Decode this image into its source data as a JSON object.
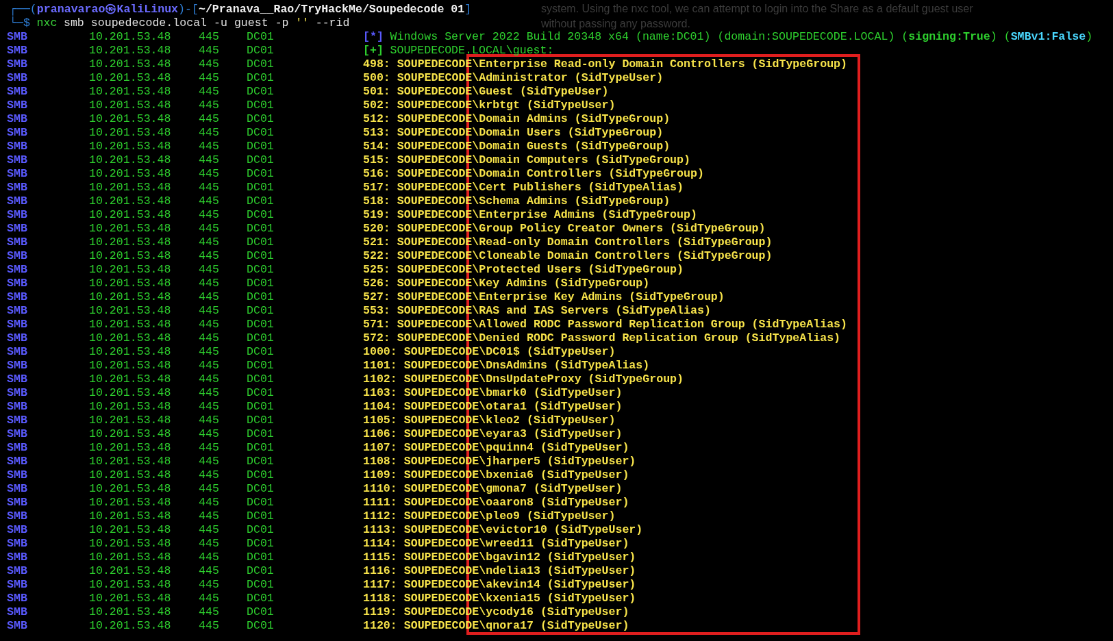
{
  "background_text": [
    "system. Using the nxc tool, we can attempt to login into the Share as a default guest user",
    "without passing any password."
  ],
  "prompt": {
    "frame_top": "┌──(",
    "user": "pranavarao㉿KaliLinux",
    "mid": ")-[",
    "path": "~/Pranava__Rao/TryHackMe/Soupedecode 01",
    "end": "]",
    "frame_bottom": "└─$",
    "command": "nxc",
    "args": "smb soupedecode.local -u guest -p",
    "quoted": "''",
    "flags": "--rid"
  },
  "rows": [
    {
      "proto": "SMB",
      "host": "10.201.53.48",
      "port": "445",
      "name": "DC01",
      "kind": "info",
      "marker": "[*]",
      "text": "Windows Server 2022 Build 20348 x64 (name:DC01) (domain:SOUPEDECODE.LOCAL) (**signing:True**) (**SMBv1:False**)"
    },
    {
      "proto": "SMB",
      "host": "10.201.53.48",
      "port": "445",
      "name": "DC01",
      "kind": "success",
      "marker": "[+]",
      "text": "SOUPEDECODE.LOCAL\\guest:"
    },
    {
      "proto": "SMB",
      "host": "10.201.53.48",
      "port": "445",
      "name": "DC01",
      "kind": "rid",
      "text": "498: SOUPEDECODE\\Enterprise Read-only Domain Controllers (SidTypeGroup)"
    },
    {
      "proto": "SMB",
      "host": "10.201.53.48",
      "port": "445",
      "name": "DC01",
      "kind": "rid",
      "text": "500: SOUPEDECODE\\Administrator (SidTypeUser)"
    },
    {
      "proto": "SMB",
      "host": "10.201.53.48",
      "port": "445",
      "name": "DC01",
      "kind": "rid",
      "text": "501: SOUPEDECODE\\Guest (SidTypeUser)"
    },
    {
      "proto": "SMB",
      "host": "10.201.53.48",
      "port": "445",
      "name": "DC01",
      "kind": "rid",
      "text": "502: SOUPEDECODE\\krbtgt (SidTypeUser)"
    },
    {
      "proto": "SMB",
      "host": "10.201.53.48",
      "port": "445",
      "name": "DC01",
      "kind": "rid",
      "text": "512: SOUPEDECODE\\Domain Admins (SidTypeGroup)"
    },
    {
      "proto": "SMB",
      "host": "10.201.53.48",
      "port": "445",
      "name": "DC01",
      "kind": "rid",
      "text": "513: SOUPEDECODE\\Domain Users (SidTypeGroup)"
    },
    {
      "proto": "SMB",
      "host": "10.201.53.48",
      "port": "445",
      "name": "DC01",
      "kind": "rid",
      "text": "514: SOUPEDECODE\\Domain Guests (SidTypeGroup)"
    },
    {
      "proto": "SMB",
      "host": "10.201.53.48",
      "port": "445",
      "name": "DC01",
      "kind": "rid",
      "text": "515: SOUPEDECODE\\Domain Computers (SidTypeGroup)"
    },
    {
      "proto": "SMB",
      "host": "10.201.53.48",
      "port": "445",
      "name": "DC01",
      "kind": "rid",
      "text": "516: SOUPEDECODE\\Domain Controllers (SidTypeGroup)"
    },
    {
      "proto": "SMB",
      "host": "10.201.53.48",
      "port": "445",
      "name": "DC01",
      "kind": "rid",
      "text": "517: SOUPEDECODE\\Cert Publishers (SidTypeAlias)"
    },
    {
      "proto": "SMB",
      "host": "10.201.53.48",
      "port": "445",
      "name": "DC01",
      "kind": "rid",
      "text": "518: SOUPEDECODE\\Schema Admins (SidTypeGroup)"
    },
    {
      "proto": "SMB",
      "host": "10.201.53.48",
      "port": "445",
      "name": "DC01",
      "kind": "rid",
      "text": "519: SOUPEDECODE\\Enterprise Admins (SidTypeGroup)"
    },
    {
      "proto": "SMB",
      "host": "10.201.53.48",
      "port": "445",
      "name": "DC01",
      "kind": "rid",
      "text": "520: SOUPEDECODE\\Group Policy Creator Owners (SidTypeGroup)"
    },
    {
      "proto": "SMB",
      "host": "10.201.53.48",
      "port": "445",
      "name": "DC01",
      "kind": "rid",
      "text": "521: SOUPEDECODE\\Read-only Domain Controllers (SidTypeGroup)"
    },
    {
      "proto": "SMB",
      "host": "10.201.53.48",
      "port": "445",
      "name": "DC01",
      "kind": "rid",
      "text": "522: SOUPEDECODE\\Cloneable Domain Controllers (SidTypeGroup)"
    },
    {
      "proto": "SMB",
      "host": "10.201.53.48",
      "port": "445",
      "name": "DC01",
      "kind": "rid",
      "text": "525: SOUPEDECODE\\Protected Users (SidTypeGroup)"
    },
    {
      "proto": "SMB",
      "host": "10.201.53.48",
      "port": "445",
      "name": "DC01",
      "kind": "rid",
      "text": "526: SOUPEDECODE\\Key Admins (SidTypeGroup)"
    },
    {
      "proto": "SMB",
      "host": "10.201.53.48",
      "port": "445",
      "name": "DC01",
      "kind": "rid",
      "text": "527: SOUPEDECODE\\Enterprise Key Admins (SidTypeGroup)"
    },
    {
      "proto": "SMB",
      "host": "10.201.53.48",
      "port": "445",
      "name": "DC01",
      "kind": "rid",
      "text": "553: SOUPEDECODE\\RAS and IAS Servers (SidTypeAlias)"
    },
    {
      "proto": "SMB",
      "host": "10.201.53.48",
      "port": "445",
      "name": "DC01",
      "kind": "rid",
      "text": "571: SOUPEDECODE\\Allowed RODC Password Replication Group (SidTypeAlias)"
    },
    {
      "proto": "SMB",
      "host": "10.201.53.48",
      "port": "445",
      "name": "DC01",
      "kind": "rid",
      "text": "572: SOUPEDECODE\\Denied RODC Password Replication Group (SidTypeAlias)"
    },
    {
      "proto": "SMB",
      "host": "10.201.53.48",
      "port": "445",
      "name": "DC01",
      "kind": "rid",
      "text": "1000: SOUPEDECODE\\DC01$ (SidTypeUser)"
    },
    {
      "proto": "SMB",
      "host": "10.201.53.48",
      "port": "445",
      "name": "DC01",
      "kind": "rid",
      "text": "1101: SOUPEDECODE\\DnsAdmins (SidTypeAlias)"
    },
    {
      "proto": "SMB",
      "host": "10.201.53.48",
      "port": "445",
      "name": "DC01",
      "kind": "rid",
      "text": "1102: SOUPEDECODE\\DnsUpdateProxy (SidTypeGroup)"
    },
    {
      "proto": "SMB",
      "host": "10.201.53.48",
      "port": "445",
      "name": "DC01",
      "kind": "rid",
      "text": "1103: SOUPEDECODE\\bmark0 (SidTypeUser)"
    },
    {
      "proto": "SMB",
      "host": "10.201.53.48",
      "port": "445",
      "name": "DC01",
      "kind": "rid",
      "text": "1104: SOUPEDECODE\\otara1 (SidTypeUser)"
    },
    {
      "proto": "SMB",
      "host": "10.201.53.48",
      "port": "445",
      "name": "DC01",
      "kind": "rid",
      "text": "1105: SOUPEDECODE\\kleo2 (SidTypeUser)"
    },
    {
      "proto": "SMB",
      "host": "10.201.53.48",
      "port": "445",
      "name": "DC01",
      "kind": "rid",
      "text": "1106: SOUPEDECODE\\eyara3 (SidTypeUser)"
    },
    {
      "proto": "SMB",
      "host": "10.201.53.48",
      "port": "445",
      "name": "DC01",
      "kind": "rid",
      "text": "1107: SOUPEDECODE\\pquinn4 (SidTypeUser)"
    },
    {
      "proto": "SMB",
      "host": "10.201.53.48",
      "port": "445",
      "name": "DC01",
      "kind": "rid",
      "text": "1108: SOUPEDECODE\\jharper5 (SidTypeUser)"
    },
    {
      "proto": "SMB",
      "host": "10.201.53.48",
      "port": "445",
      "name": "DC01",
      "kind": "rid",
      "text": "1109: SOUPEDECODE\\bxenia6 (SidTypeUser)"
    },
    {
      "proto": "SMB",
      "host": "10.201.53.48",
      "port": "445",
      "name": "DC01",
      "kind": "rid",
      "text": "1110: SOUPEDECODE\\gmona7 (SidTypeUser)"
    },
    {
      "proto": "SMB",
      "host": "10.201.53.48",
      "port": "445",
      "name": "DC01",
      "kind": "rid",
      "text": "1111: SOUPEDECODE\\oaaron8 (SidTypeUser)"
    },
    {
      "proto": "SMB",
      "host": "10.201.53.48",
      "port": "445",
      "name": "DC01",
      "kind": "rid",
      "text": "1112: SOUPEDECODE\\pleo9 (SidTypeUser)"
    },
    {
      "proto": "SMB",
      "host": "10.201.53.48",
      "port": "445",
      "name": "DC01",
      "kind": "rid",
      "text": "1113: SOUPEDECODE\\evictor10 (SidTypeUser)"
    },
    {
      "proto": "SMB",
      "host": "10.201.53.48",
      "port": "445",
      "name": "DC01",
      "kind": "rid",
      "text": "1114: SOUPEDECODE\\wreed11 (SidTypeUser)"
    },
    {
      "proto": "SMB",
      "host": "10.201.53.48",
      "port": "445",
      "name": "DC01",
      "kind": "rid",
      "text": "1115: SOUPEDECODE\\bgavin12 (SidTypeUser)"
    },
    {
      "proto": "SMB",
      "host": "10.201.53.48",
      "port": "445",
      "name": "DC01",
      "kind": "rid",
      "text": "1116: SOUPEDECODE\\ndelia13 (SidTypeUser)"
    },
    {
      "proto": "SMB",
      "host": "10.201.53.48",
      "port": "445",
      "name": "DC01",
      "kind": "rid",
      "text": "1117: SOUPEDECODE\\akevin14 (SidTypeUser)"
    },
    {
      "proto": "SMB",
      "host": "10.201.53.48",
      "port": "445",
      "name": "DC01",
      "kind": "rid",
      "text": "1118: SOUPEDECODE\\kxenia15 (SidTypeUser)"
    },
    {
      "proto": "SMB",
      "host": "10.201.53.48",
      "port": "445",
      "name": "DC01",
      "kind": "rid",
      "text": "1119: SOUPEDECODE\\ycody16 (SidTypeUser)"
    },
    {
      "proto": "SMB",
      "host": "10.201.53.48",
      "port": "445",
      "name": "DC01",
      "kind": "rid",
      "text": "1120: SOUPEDECODE\\qnora17 (SidTypeUser)"
    }
  ]
}
